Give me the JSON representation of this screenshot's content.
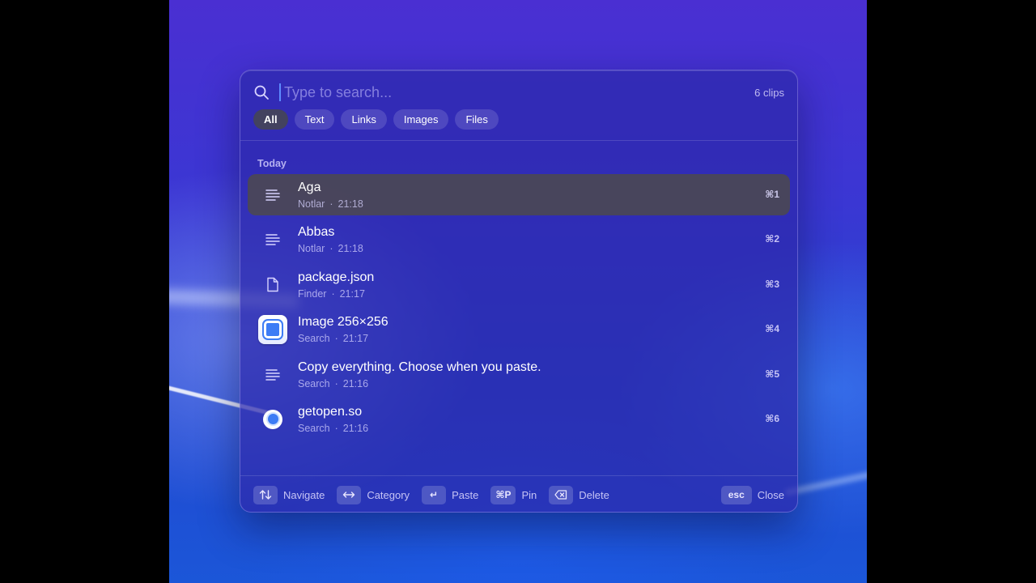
{
  "search": {
    "placeholder": "Type to search...",
    "value": "",
    "count_label": "6 clips"
  },
  "filters": [
    {
      "label": "All",
      "active": true
    },
    {
      "label": "Text",
      "active": false
    },
    {
      "label": "Links",
      "active": false
    },
    {
      "label": "Images",
      "active": false
    },
    {
      "label": "Files",
      "active": false
    }
  ],
  "section": {
    "label": "Today"
  },
  "clips": [
    {
      "title": "Aga",
      "source": "Notlar",
      "time": "21:18",
      "shortcut": "⌘1",
      "icon": "text-lines-icon",
      "selected": true
    },
    {
      "title": "Abbas",
      "source": "Notlar",
      "time": "21:18",
      "shortcut": "⌘2",
      "icon": "text-lines-icon",
      "selected": false
    },
    {
      "title": "package.json",
      "source": "Finder",
      "time": "21:17",
      "shortcut": "⌘3",
      "icon": "file-icon",
      "selected": false
    },
    {
      "title": "Image 256×256",
      "source": "Search",
      "time": "21:17",
      "shortcut": "⌘4",
      "icon": "image-app-icon",
      "selected": false
    },
    {
      "title": "Copy everything. Choose when you paste.",
      "source": "Search",
      "time": "21:16",
      "shortcut": "⌘5",
      "icon": "text-lines-icon",
      "selected": false
    },
    {
      "title": "getopen.so",
      "source": "Search",
      "time": "21:16",
      "shortcut": "⌘6",
      "icon": "link-favicon-icon",
      "selected": false
    }
  ],
  "separator": "·",
  "footer": {
    "navigate": {
      "key": "",
      "label": "Navigate"
    },
    "category": {
      "key": "",
      "label": "Category"
    },
    "paste": {
      "key": "↵",
      "label": "Paste"
    },
    "pin": {
      "key": "⌘P",
      "label": "Pin"
    },
    "delete": {
      "key": "",
      "label": "Delete"
    },
    "close": {
      "key": "esc",
      "label": "Close"
    }
  },
  "colors": {
    "accent": "#3d7cf5",
    "selected_row": "#4b4855",
    "panel": "#2d28aa"
  }
}
